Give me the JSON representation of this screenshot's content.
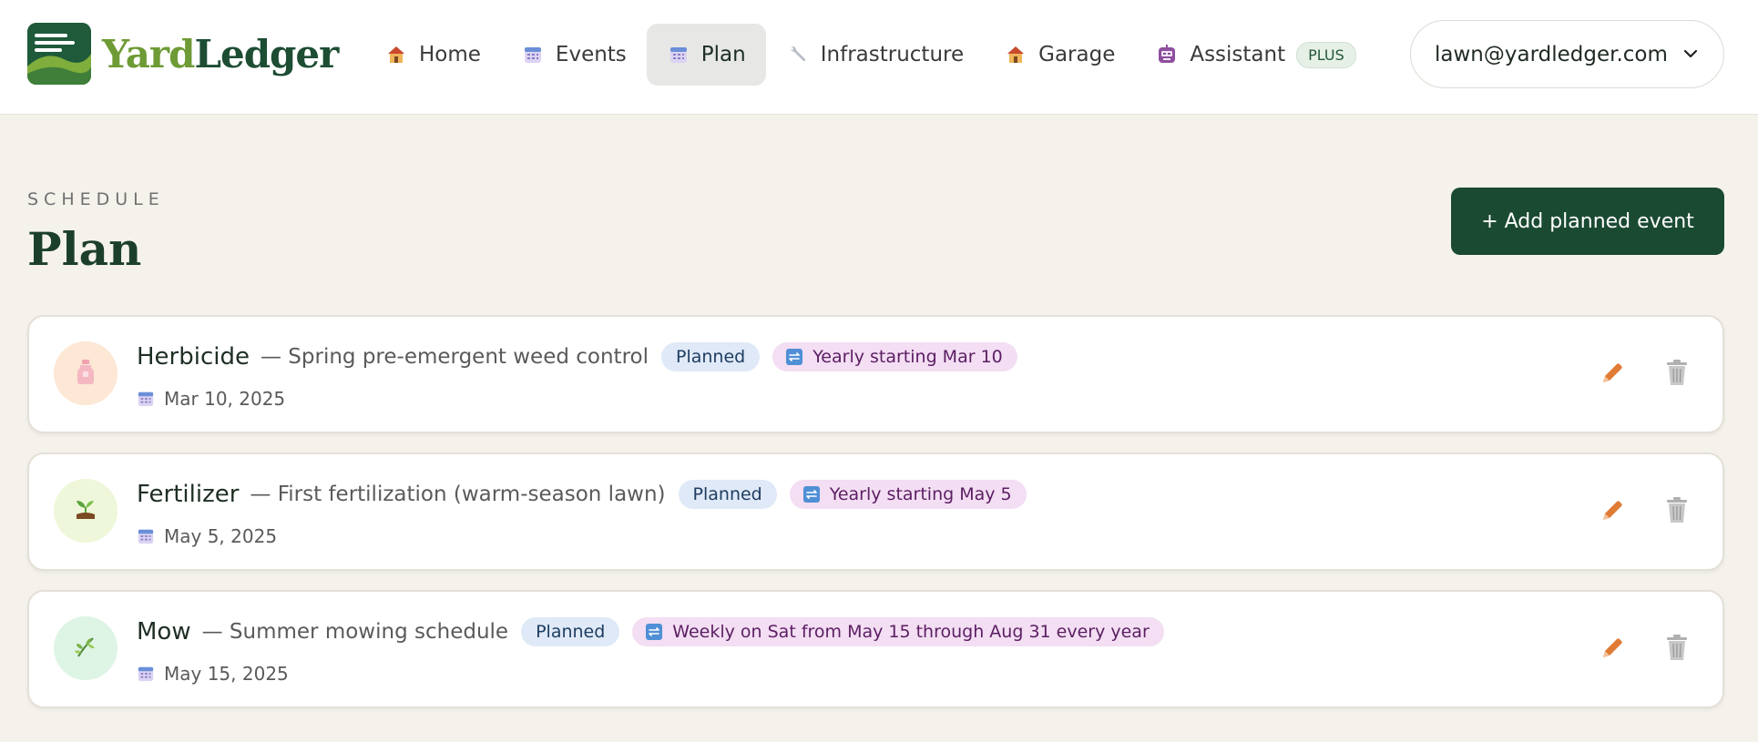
{
  "app": {
    "logo_part1": "Yard",
    "logo_part2": "Ledger"
  },
  "nav": {
    "items": [
      {
        "label": "Home",
        "icon": "house-icon"
      },
      {
        "label": "Events",
        "icon": "calendar-icon"
      },
      {
        "label": "Plan",
        "icon": "calendar-icon",
        "active": true
      },
      {
        "label": "Infrastructure",
        "icon": "wrench-icon"
      },
      {
        "label": "Garage",
        "icon": "garage-icon"
      },
      {
        "label": "Assistant",
        "icon": "robot-icon",
        "badge": "PLUS"
      }
    ]
  },
  "account": {
    "email": "lawn@yardledger.com"
  },
  "page": {
    "eyebrow": "SCHEDULE",
    "title": "Plan",
    "add_button": "+ Add planned event"
  },
  "events": [
    {
      "name": "Herbicide",
      "description": "— Spring pre-emergent weed control",
      "status": "Planned",
      "recurrence": "Yearly starting Mar 10",
      "date": "Mar 10, 2025",
      "icon": "spray-bottle-icon",
      "avatar_color": "#fde7d5"
    },
    {
      "name": "Fertilizer",
      "description": "— First fertilization (warm-season lawn)",
      "status": "Planned",
      "recurrence": "Yearly starting May 5",
      "date": "May 5, 2025",
      "icon": "seedling-icon",
      "avatar_color": "#eef7d9"
    },
    {
      "name": "Mow",
      "description": "— Summer mowing schedule",
      "status": "Planned",
      "recurrence": "Weekly on Sat from May 15 through Aug 31 every year",
      "date": "May 15, 2025",
      "icon": "herb-icon",
      "avatar_color": "#def5e6"
    }
  ],
  "colors": {
    "brand_dark": "#1b4a33",
    "brand_light": "#6e9b35",
    "planned_badge_bg": "#dfe9f7",
    "recur_badge_bg": "#f3def3",
    "edit_icon": "#e07b35",
    "trash_icon": "#b0b0b0"
  }
}
